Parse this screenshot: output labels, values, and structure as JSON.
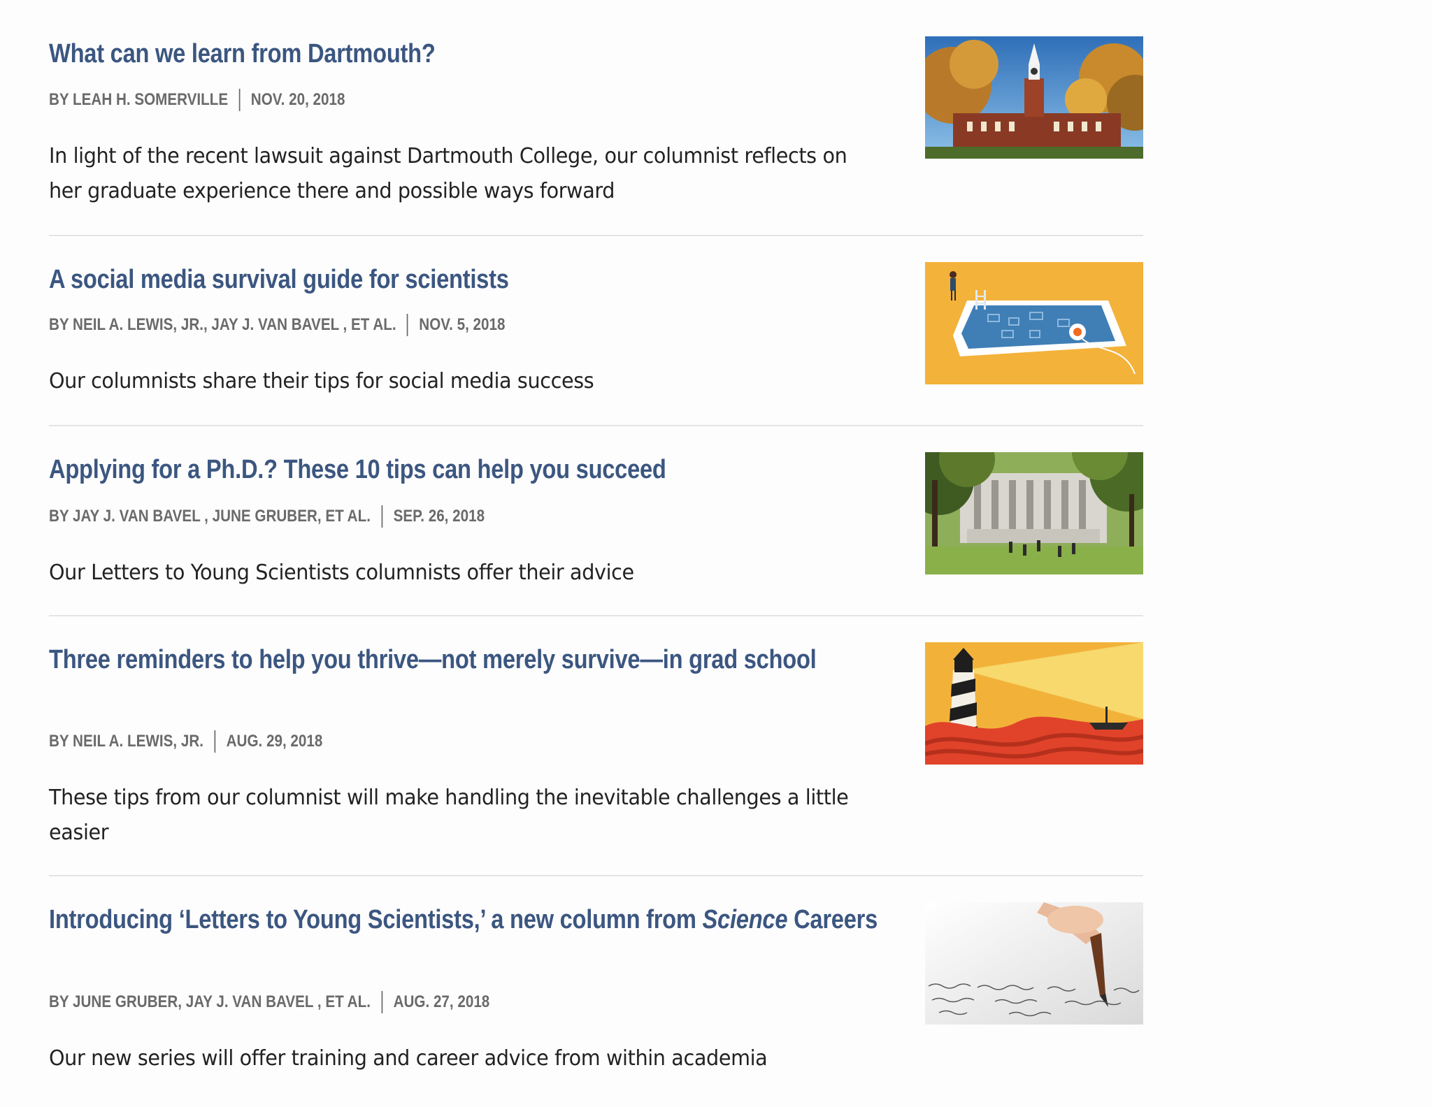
{
  "articles": [
    {
      "title": "What can we learn from Dartmouth?",
      "authors": "BY LEAH H. SOMERVILLE",
      "date": "NOV. 20, 2018",
      "summary": "In light of the recent lawsuit against Dartmouth College, our columnist reflects on her graduate experience there and possible ways forward",
      "image": "dartmouth-clocktower-image"
    },
    {
      "title": "A social media survival guide for scientists",
      "authors": "BY NEIL A. LEWIS, JR., JAY J. VAN BAVEL , ET AL.",
      "date": "NOV. 5, 2018",
      "summary": "Our columnists share their tips for social media success",
      "image": "tablet-pool-illustration"
    },
    {
      "title": "Applying for a Ph.D.? These 10 tips can help you succeed",
      "authors": "BY JAY J. VAN BAVEL , JUNE GRUBER, ET AL.",
      "date": "SEP. 26, 2018",
      "summary": "Our Letters to Young Scientists columnists offer their advice",
      "image": "campus-library-image"
    },
    {
      "title": "Three reminders to help you thrive—not merely survive—in grad school",
      "authors": "BY NEIL A. LEWIS, JR.",
      "date": "AUG. 29, 2018",
      "summary": "These tips from our columnist will make handling the inevitable challenges a little easier",
      "image": "lighthouse-illustration"
    },
    {
      "title_prefix": "Introducing ‘Letters to Young Scientists,’ a new column from ",
      "title_italic": "Science",
      "title_suffix": " Careers",
      "authors": "BY JUNE GRUBER, JAY J. VAN BAVEL , ET AL.",
      "date": "AUG. 27, 2018",
      "summary": "Our new series will offer training and career advice from within academia",
      "image": "fountain-pen-writing-image"
    }
  ],
  "colors": {
    "title": "#3b5680",
    "byline": "#6a6a6a",
    "summary": "#222222",
    "divider": "#e4e4e4"
  }
}
